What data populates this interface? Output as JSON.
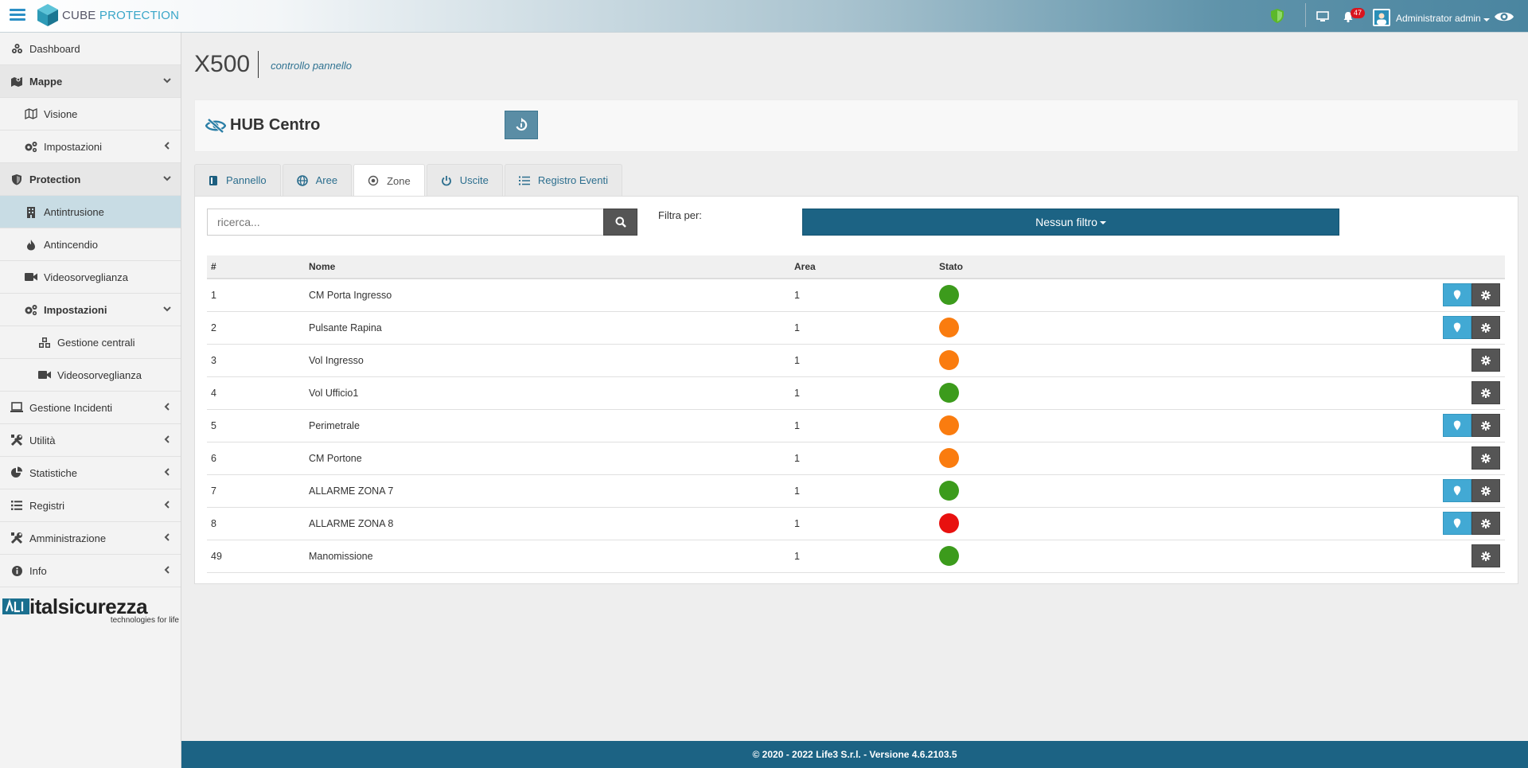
{
  "app": {
    "logo_part1": "CUBE",
    "logo_part2": "PROTECTION"
  },
  "topbar": {
    "notifications_count": "47",
    "user_label": "Administrator admin"
  },
  "sidebar": {
    "items": [
      {
        "label": "Dashboard",
        "icon": "dashboard-icon"
      },
      {
        "label": "Mappe",
        "icon": "map-marked-icon"
      },
      {
        "label": "Visione",
        "icon": "map-icon"
      },
      {
        "label": "Impostazioni",
        "icon": "cogs-icon"
      },
      {
        "label": "Protection",
        "icon": "shield-icon"
      },
      {
        "label": "Antintrusione",
        "icon": "building-icon"
      },
      {
        "label": "Antincendio",
        "icon": "fire-icon"
      },
      {
        "label": "Videosorveglianza",
        "icon": "video-camera-icon"
      },
      {
        "label": "Impostazioni",
        "icon": "cogs-icon"
      },
      {
        "label": "Gestione centrali",
        "icon": "cubes-icon"
      },
      {
        "label": "Videosorveglianza",
        "icon": "video-camera-icon"
      },
      {
        "label": "Gestione Incidenti",
        "icon": "laptop-icon"
      },
      {
        "label": "Utilità",
        "icon": "tools-icon"
      },
      {
        "label": "Statistiche",
        "icon": "pie-chart-icon"
      },
      {
        "label": "Registri",
        "icon": "list-icon"
      },
      {
        "label": "Amministrazione",
        "icon": "tools-icon"
      },
      {
        "label": "Info",
        "icon": "info-icon"
      }
    ],
    "brand_name": "italsicurezza",
    "brand_tagline": "technologies for life"
  },
  "page": {
    "title": "X500",
    "subtitle": "controllo pannello"
  },
  "panel_header": {
    "title": "HUB Centro"
  },
  "tabs": [
    {
      "label": "Pannello",
      "icon": "panel-icon"
    },
    {
      "label": "Aree",
      "icon": "globe-icon"
    },
    {
      "label": "Zone",
      "icon": "dot-circle-icon"
    },
    {
      "label": "Uscite",
      "icon": "power-icon"
    },
    {
      "label": "Registro Eventi",
      "icon": "list-icon"
    }
  ],
  "search": {
    "placeholder": "ricerca..."
  },
  "filter": {
    "label": "Filtra per:",
    "button": "Nessun filtro"
  },
  "table": {
    "headers": {
      "num": "#",
      "name": "Nome",
      "area": "Area",
      "status": "Stato"
    },
    "status_colors": {
      "green": "#3c9b1c",
      "orange": "#fa7c0f",
      "red": "#e8110f"
    },
    "rows": [
      {
        "num": "1",
        "name": "CM Porta Ingresso",
        "area": "1",
        "status": "green",
        "map": true
      },
      {
        "num": "2",
        "name": "Pulsante Rapina",
        "area": "1",
        "status": "orange",
        "map": true
      },
      {
        "num": "3",
        "name": "Vol Ingresso",
        "area": "1",
        "status": "orange",
        "map": false
      },
      {
        "num": "4",
        "name": "Vol Ufficio1",
        "area": "1",
        "status": "green",
        "map": false
      },
      {
        "num": "5",
        "name": "Perimetrale",
        "area": "1",
        "status": "orange",
        "map": true
      },
      {
        "num": "6",
        "name": "CM Portone",
        "area": "1",
        "status": "orange",
        "map": false
      },
      {
        "num": "7",
        "name": "ALLARME ZONA 7",
        "area": "1",
        "status": "green",
        "map": true
      },
      {
        "num": "8",
        "name": "ALLARME ZONA 8",
        "area": "1",
        "status": "red",
        "map": true
      },
      {
        "num": "49",
        "name": "Manomissione",
        "area": "1",
        "status": "green",
        "map": false
      }
    ]
  },
  "footer": {
    "text": "© 2020 - 2022 Life3 S.r.l. - Versione 4.6.2103.5"
  }
}
